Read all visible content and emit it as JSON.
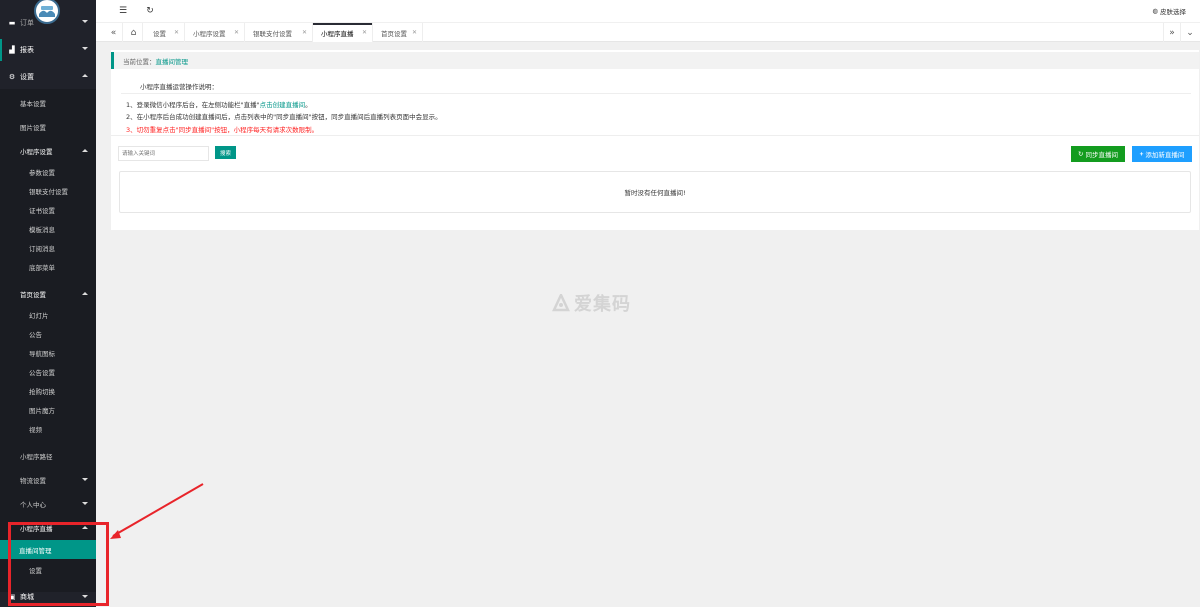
{
  "sidebar": {
    "top_partial": "订单",
    "items": [
      {
        "label": "报表",
        "icon": "bar-chart-icon"
      },
      {
        "label": "设置",
        "icon": "gear-icon"
      }
    ],
    "settings_sub": [
      "基本设置",
      "图片设置"
    ],
    "miniapp_settings": {
      "label": "小程序设置",
      "items": [
        "参数设置",
        "银联支付设置",
        "证书设置",
        "模板消息",
        "订阅消息",
        "底部菜单"
      ]
    },
    "home_settings": {
      "label": "首页设置",
      "items": [
        "幻灯片",
        "公告",
        "导航图标",
        "公告设置",
        "抢购切换",
        "图片魔方",
        "视频"
      ]
    },
    "miniapp_path": "小程序路径",
    "logistics": "物流设置",
    "personal": "个人中心",
    "live": {
      "label": "小程序直播",
      "items": [
        "直播间管理",
        "设置"
      ]
    },
    "mall": "商城"
  },
  "topbar": {
    "skin_label": "皮肤选择"
  },
  "tabs": [
    "设置",
    "小程序设置",
    "银联支付设置",
    "小程序直播",
    "首页设置"
  ],
  "breadcrumb": {
    "prefix": "当前位置：",
    "current": "直播间管理"
  },
  "desc": {
    "heading": "小程序直播运营操作说明：",
    "line1_a": "1、登录微信小程序后台，在左侧功能栏\"直播\"",
    "line1_link": "点击创建直播间",
    "line1_b": "。",
    "line2": "2、在小程序后台成功创建直播间后，点击列表中的\"同步直播间\"按钮，同步直播间后直播列表页面中会显示。",
    "line3": "3、切勿重复点击\"同步直播间\"按钮，小程序每天有请求次数限制。"
  },
  "search": {
    "placeholder": "请输入关键词",
    "button": "搜索"
  },
  "actions": {
    "sync": "同步直播间",
    "add": "添加新直播间"
  },
  "empty_text": "暂时没有任何直播间!",
  "watermark": "爱集码",
  "colors": {
    "accent": "#009688",
    "sidebar": "#20222a",
    "sync": "#139c1f",
    "add": "#1e9fff",
    "warning": "#ff2222"
  }
}
